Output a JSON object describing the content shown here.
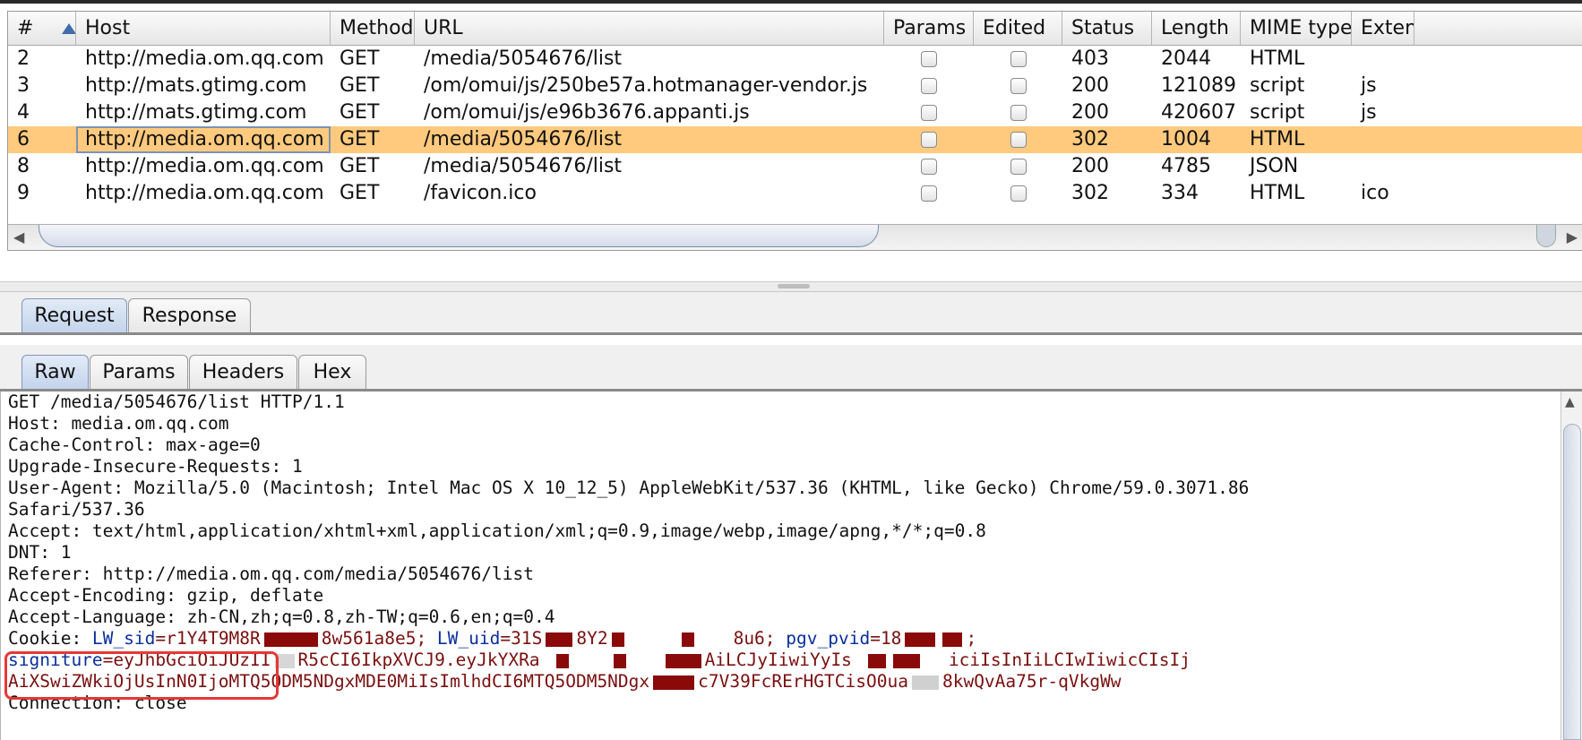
{
  "table": {
    "columns": [
      "#",
      "Host",
      "Method",
      "URL",
      "Params",
      "Edited",
      "Status",
      "Length",
      "MIME type",
      "Exten"
    ],
    "rows": [
      {
        "num": "2",
        "host": "http://media.om.qq.com",
        "method": "GET",
        "url": "/media/5054676/list",
        "params": false,
        "edited": false,
        "status": "403",
        "length": "2044",
        "mime": "HTML",
        "ext": ""
      },
      {
        "num": "3",
        "host": "http://mats.gtimg.com",
        "method": "GET",
        "url": "/om/omui/js/250be57a.hotmanager-vendor.js",
        "params": false,
        "edited": false,
        "status": "200",
        "length": "121089",
        "mime": "script",
        "ext": "js"
      },
      {
        "num": "4",
        "host": "http://mats.gtimg.com",
        "method": "GET",
        "url": "/om/omui/js/e96b3676.appanti.js",
        "params": false,
        "edited": false,
        "status": "200",
        "length": "420607",
        "mime": "script",
        "ext": "js"
      },
      {
        "num": "6",
        "host": "http://media.om.qq.com",
        "method": "GET",
        "url": "/media/5054676/list",
        "params": false,
        "edited": false,
        "status": "302",
        "length": "1004",
        "mime": "HTML",
        "ext": "",
        "selected": true
      },
      {
        "num": "8",
        "host": "http://media.om.qq.com",
        "method": "GET",
        "url": "/media/5054676/list",
        "params": false,
        "edited": false,
        "status": "200",
        "length": "4785",
        "mime": "JSON",
        "ext": ""
      },
      {
        "num": "9",
        "host": "http://media.om.qq.com",
        "method": "GET",
        "url": "/favicon.ico",
        "params": false,
        "edited": false,
        "status": "302",
        "length": "334",
        "mime": "HTML",
        "ext": "ico"
      }
    ]
  },
  "scrollbar": {
    "left_arrow": "◀",
    "right_arrow": "▶",
    "up_arrow": "▲"
  },
  "message_tabs": [
    {
      "label": "Request",
      "active": true
    },
    {
      "label": "Response",
      "active": false
    }
  ],
  "view_tabs": [
    {
      "label": "Raw",
      "active": true
    },
    {
      "label": "Params",
      "active": false
    },
    {
      "label": "Headers",
      "active": false
    },
    {
      "label": "Hex",
      "active": false
    }
  ],
  "raw": {
    "request_line": "GET /media/5054676/list HTTP/1.1",
    "host": "Host: media.om.qq.com",
    "cache_control": "Cache-Control: max-age=0",
    "upgrade": "Upgrade-Insecure-Requests: 1",
    "user_agent_1": "User-Agent: Mozilla/5.0 (Macintosh; Intel Mac OS X 10_12_5) AppleWebKit/537.36 (KHTML, like Gecko) Chrome/59.0.3071.86",
    "user_agent_2": "Safari/537.36",
    "accept": "Accept: text/html,application/xhtml+xml,application/xml;q=0.9,image/webp,image/apng,*/*;q=0.8",
    "dnt": "DNT: 1",
    "referer": "Referer: http://media.om.qq.com/media/5054676/list",
    "accept_encoding": "Accept-Encoding: gzip, deflate",
    "accept_language": "Accept-Language: zh-CN,zh;q=0.8,zh-TW;q=0.6,en;q=0.4",
    "cookie": {
      "label": "Cookie: ",
      "k1": "LW_sid",
      "v1a": "=r1Y4T9M8R",
      "v1b": "8w561a8e5; ",
      "k2": "LW_uid",
      "v2a": "=31S",
      "v2b": "8Y2",
      "v2c": "8u6; ",
      "k3": "pgv_pvid",
      "v3a": "=18",
      "v3b": ";"
    },
    "sig": {
      "key": "signiture",
      "v_a": "=eyJhbGciOiJ",
      "v_b": "UzII",
      "v_c": "R5cCI6IkpXVCJ9.eyJkYXRa",
      "v_d": "AiLCJyIiwiYyIs",
      "v_e": "iciIsInIiLCIwIiwicCIsIj",
      "line2_a": "AiXSwiZWkiOjUsInN0Ijo",
      "line2_b": "MTQ5ODM5NDgxMDE0MiIsImlhdCI6MTQ5ODM5NDgx",
      "line2_c": "c7V39FcRErHGTCisO0ua",
      "line2_d": "8kwQvAa75r-qVkgWw"
    },
    "connection": "Connection: close"
  },
  "colors": {
    "selected_row": "#ffca7e",
    "highlight_box": "#e53935",
    "header_key": "#0b2f9c",
    "header_value": "#7a1010"
  }
}
